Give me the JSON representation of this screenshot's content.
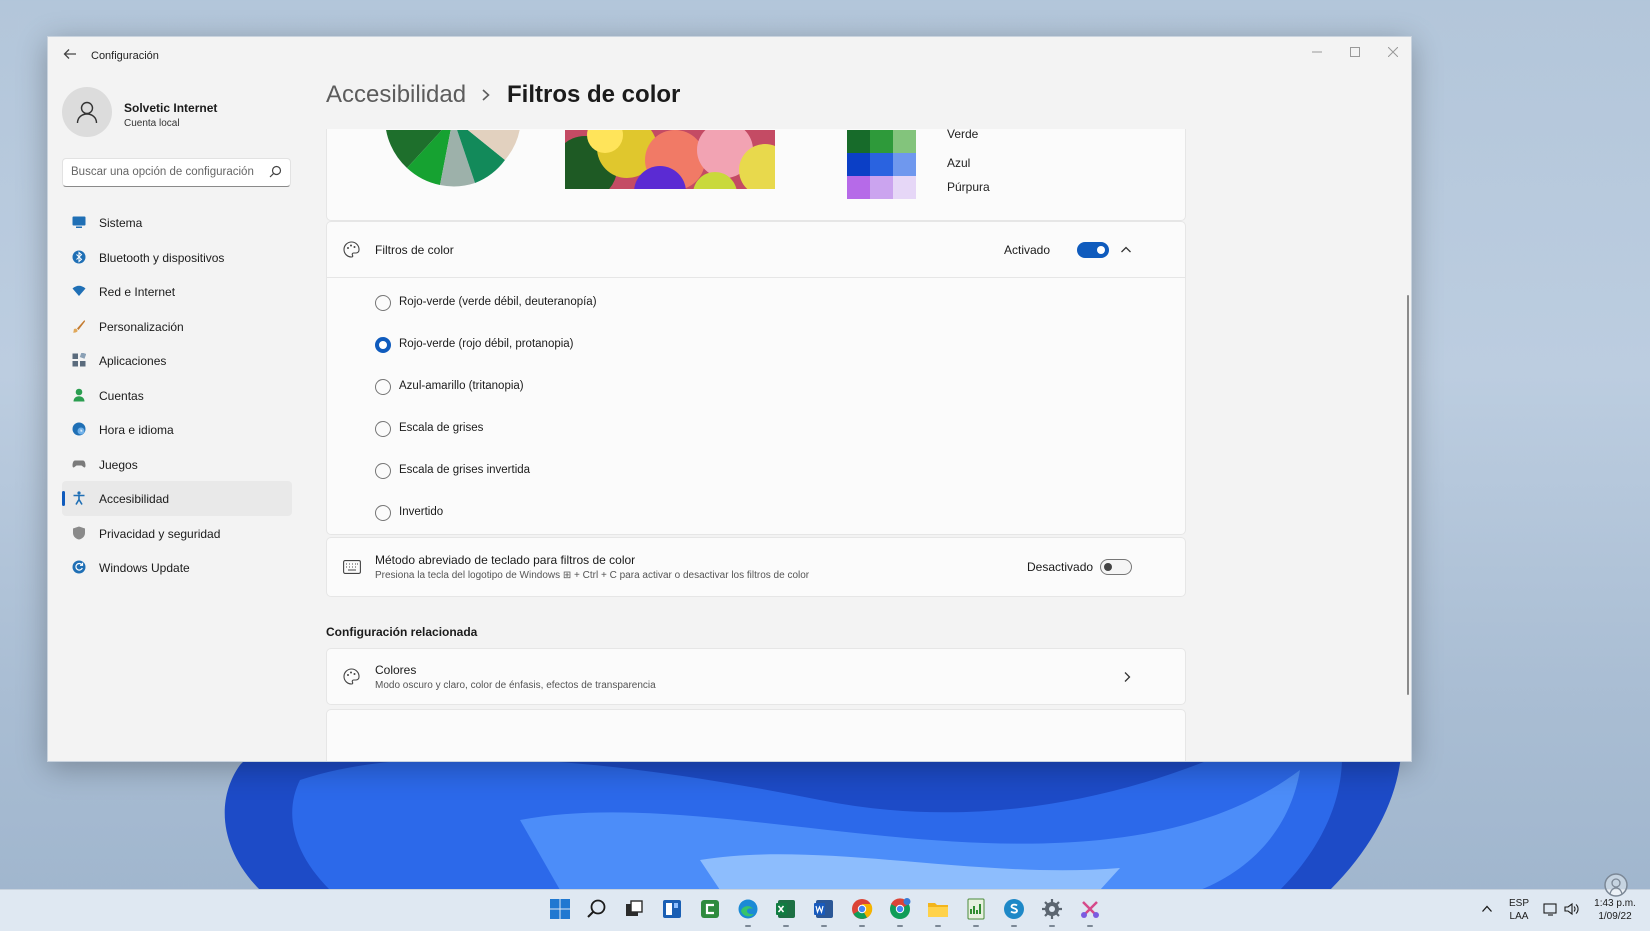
{
  "window": {
    "title": "Configuración",
    "back_icon": "arrow-left-icon"
  },
  "profile": {
    "name": "Solvetic Internet",
    "account_type": "Cuenta local"
  },
  "search": {
    "placeholder": "Buscar una opción de configuración"
  },
  "sidebar": {
    "items": [
      {
        "label": "Sistema",
        "icon": "monitor-icon",
        "color": "#1f6fb5"
      },
      {
        "label": "Bluetooth y dispositivos",
        "icon": "bluetooth-icon",
        "color": "#1f6fb5"
      },
      {
        "label": "Red e Internet",
        "icon": "wifi-icon",
        "color": "#1f6fb5"
      },
      {
        "label": "Personalización",
        "icon": "brush-icon",
        "color": "#d08a2e"
      },
      {
        "label": "Aplicaciones",
        "icon": "apps-icon",
        "color": "#5a6b7c"
      },
      {
        "label": "Cuentas",
        "icon": "person-icon",
        "color": "#2b9e50"
      },
      {
        "label": "Hora e idioma",
        "icon": "globe-clock-icon",
        "color": "#1f6fb5"
      },
      {
        "label": "Juegos",
        "icon": "gamepad-icon",
        "color": "#7a7a7a"
      },
      {
        "label": "Accesibilidad",
        "icon": "accessibility-icon",
        "color": "#1f6fb5"
      },
      {
        "label": "Privacidad y seguridad",
        "icon": "shield-icon",
        "color": "#7a7a7a"
      },
      {
        "label": "Windows Update",
        "icon": "update-icon",
        "color": "#1f6fb5"
      }
    ],
    "active_index": 8
  },
  "breadcrumb": {
    "parent": "Accesibilidad",
    "current": "Filtros de color"
  },
  "preview": {
    "swatch_labels": [
      "Verde",
      "Azul",
      "Púrpura"
    ]
  },
  "color_filters": {
    "title": "Filtros de color",
    "state_label": "Activado",
    "enabled": true,
    "options": [
      {
        "label": "Rojo-verde (verde débil, deuteranopía)",
        "selected": false
      },
      {
        "label": "Rojo-verde (rojo débil, protanopia)",
        "selected": true
      },
      {
        "label": "Azul-amarillo (tritanopia)",
        "selected": false
      },
      {
        "label": "Escala de grises",
        "selected": false
      },
      {
        "label": "Escala de grises invertida",
        "selected": false
      },
      {
        "label": "Invertido",
        "selected": false
      }
    ]
  },
  "shortcut": {
    "title": "Método abreviado de teclado para filtros de color",
    "description": "Presiona la tecla del logotipo de Windows ⊞ + Ctrl + C para activar o desactivar los filtros de color",
    "state_label": "Desactivado",
    "enabled": false
  },
  "related": {
    "section_title": "Configuración relacionada",
    "colores_title": "Colores",
    "colores_sub": "Modo oscuro y claro, color de énfasis, efectos de transparencia"
  },
  "taskbar": {
    "lang_top": "ESP",
    "lang_bottom": "LAA",
    "time": "1:43 p.m.",
    "date": "1/09/22"
  },
  "colors": {
    "accent": "#0f5bbd"
  }
}
